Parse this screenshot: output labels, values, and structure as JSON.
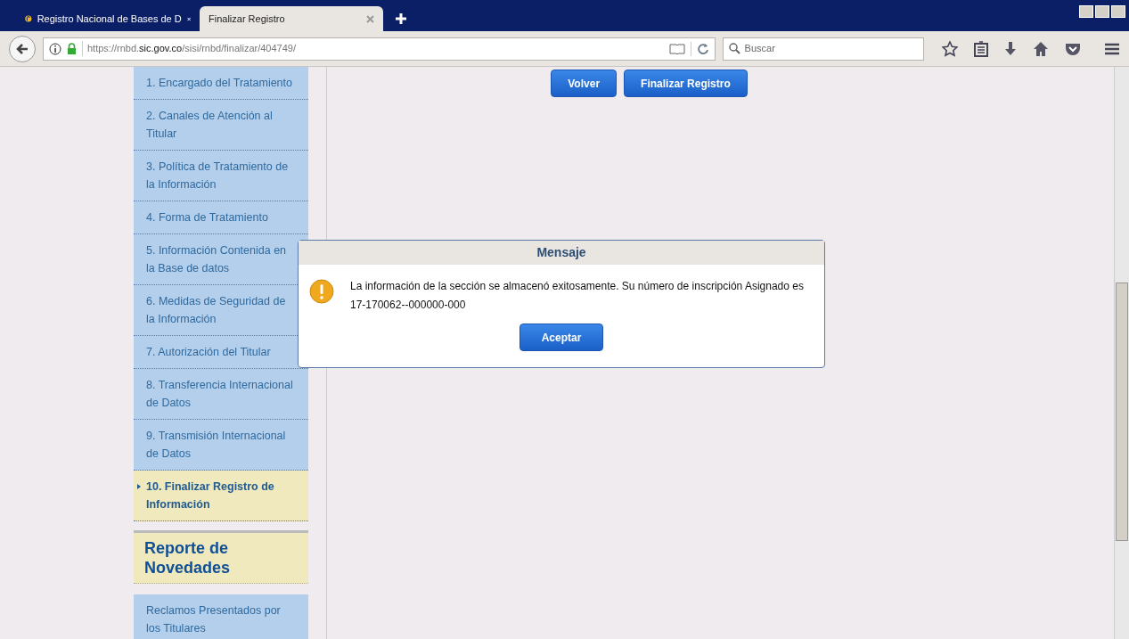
{
  "browser": {
    "tabs": [
      {
        "title": "Registro Nacional de Bases de D",
        "selected": false
      },
      {
        "title": "Finalizar Registro",
        "selected": true
      }
    ],
    "url": {
      "scheme_sub": "https://rnbd.",
      "host": "sic.gov.co",
      "path": "/sisi/rnbd/finalizar/404749/"
    },
    "search": {
      "placeholder": "Buscar"
    }
  },
  "actions": [
    {
      "label": "Volver"
    },
    {
      "label": "Finalizar Registro"
    }
  ],
  "sidebar": {
    "items": [
      {
        "label": "1. Encargado del Tratamiento",
        "selected": false
      },
      {
        "label": "2. Canales de Atención al Titular",
        "selected": false
      },
      {
        "label": "3. Política de Tratamiento de la Información",
        "selected": false
      },
      {
        "label": "4. Forma de Tratamiento",
        "selected": false
      },
      {
        "label": "5. Información Contenida en la Base de datos",
        "selected": false
      },
      {
        "label": "6. Medidas de Seguridad de la Información",
        "selected": false
      },
      {
        "label": "7. Autorización del Titular",
        "selected": false
      },
      {
        "label": "8. Transferencia Internacional de Datos",
        "selected": false
      },
      {
        "label": "9. Transmisión Internacional de Datos",
        "selected": false
      },
      {
        "label": "10. Finalizar Registro de Información",
        "selected": true
      }
    ],
    "section": {
      "title": "Reporte de Novedades",
      "items": [
        {
          "label": "Reclamos Presentados por los Titulares"
        }
      ]
    }
  },
  "dialog": {
    "title": "Mensaje",
    "message": "La información de la sección se almacenó exitosamente. Su número de inscripción Asignado es 17-170062--000000-000",
    "button": "Aceptar"
  }
}
